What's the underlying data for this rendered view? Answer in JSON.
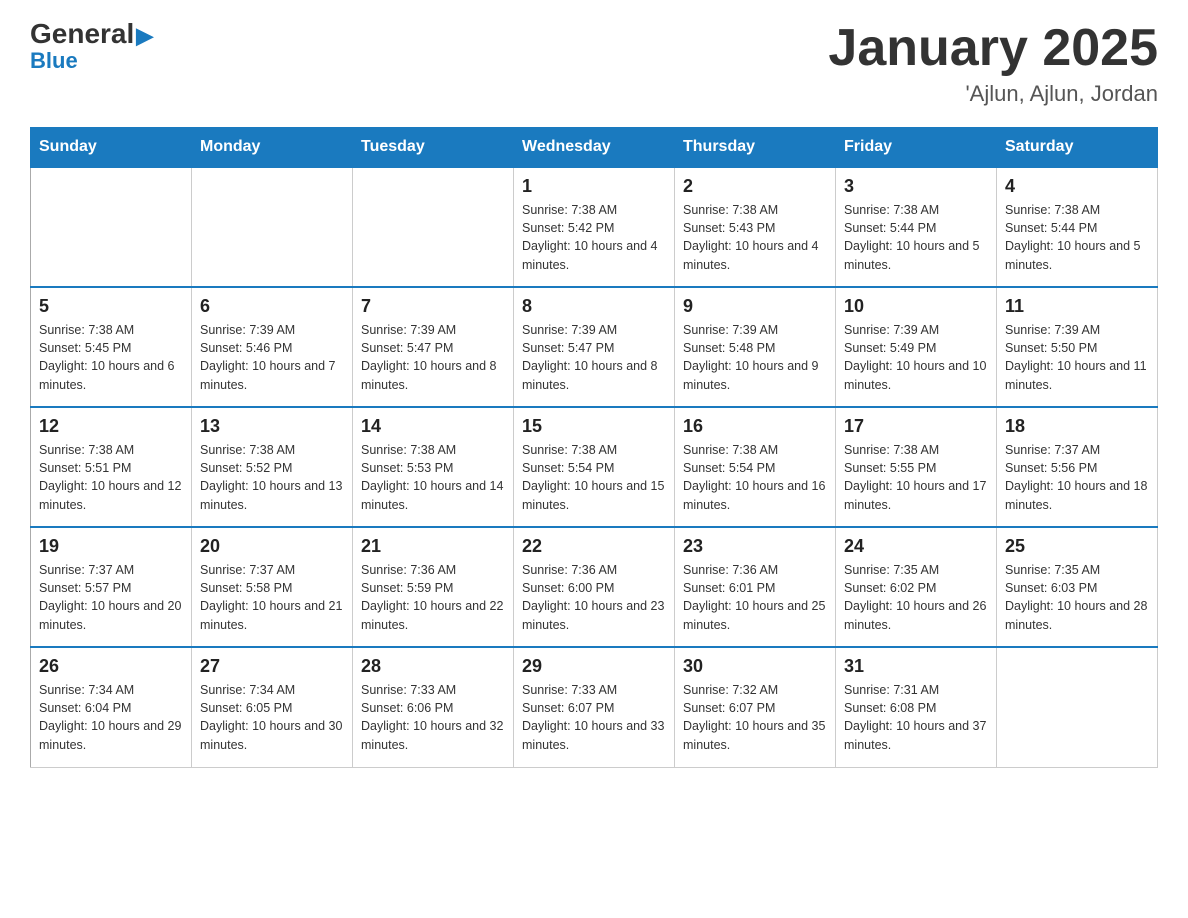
{
  "logo": {
    "general": "General",
    "blue": "Blue",
    "arrow": "▶"
  },
  "title": "January 2025",
  "subtitle": "'Ajlun, Ajlun, Jordan",
  "headers": [
    "Sunday",
    "Monday",
    "Tuesday",
    "Wednesday",
    "Thursday",
    "Friday",
    "Saturday"
  ],
  "weeks": [
    [
      {
        "day": "",
        "info": ""
      },
      {
        "day": "",
        "info": ""
      },
      {
        "day": "",
        "info": ""
      },
      {
        "day": "1",
        "info": "Sunrise: 7:38 AM\nSunset: 5:42 PM\nDaylight: 10 hours and 4 minutes."
      },
      {
        "day": "2",
        "info": "Sunrise: 7:38 AM\nSunset: 5:43 PM\nDaylight: 10 hours and 4 minutes."
      },
      {
        "day": "3",
        "info": "Sunrise: 7:38 AM\nSunset: 5:44 PM\nDaylight: 10 hours and 5 minutes."
      },
      {
        "day": "4",
        "info": "Sunrise: 7:38 AM\nSunset: 5:44 PM\nDaylight: 10 hours and 5 minutes."
      }
    ],
    [
      {
        "day": "5",
        "info": "Sunrise: 7:38 AM\nSunset: 5:45 PM\nDaylight: 10 hours and 6 minutes."
      },
      {
        "day": "6",
        "info": "Sunrise: 7:39 AM\nSunset: 5:46 PM\nDaylight: 10 hours and 7 minutes."
      },
      {
        "day": "7",
        "info": "Sunrise: 7:39 AM\nSunset: 5:47 PM\nDaylight: 10 hours and 8 minutes."
      },
      {
        "day": "8",
        "info": "Sunrise: 7:39 AM\nSunset: 5:47 PM\nDaylight: 10 hours and 8 minutes."
      },
      {
        "day": "9",
        "info": "Sunrise: 7:39 AM\nSunset: 5:48 PM\nDaylight: 10 hours and 9 minutes."
      },
      {
        "day": "10",
        "info": "Sunrise: 7:39 AM\nSunset: 5:49 PM\nDaylight: 10 hours and 10 minutes."
      },
      {
        "day": "11",
        "info": "Sunrise: 7:39 AM\nSunset: 5:50 PM\nDaylight: 10 hours and 11 minutes."
      }
    ],
    [
      {
        "day": "12",
        "info": "Sunrise: 7:38 AM\nSunset: 5:51 PM\nDaylight: 10 hours and 12 minutes."
      },
      {
        "day": "13",
        "info": "Sunrise: 7:38 AM\nSunset: 5:52 PM\nDaylight: 10 hours and 13 minutes."
      },
      {
        "day": "14",
        "info": "Sunrise: 7:38 AM\nSunset: 5:53 PM\nDaylight: 10 hours and 14 minutes."
      },
      {
        "day": "15",
        "info": "Sunrise: 7:38 AM\nSunset: 5:54 PM\nDaylight: 10 hours and 15 minutes."
      },
      {
        "day": "16",
        "info": "Sunrise: 7:38 AM\nSunset: 5:54 PM\nDaylight: 10 hours and 16 minutes."
      },
      {
        "day": "17",
        "info": "Sunrise: 7:38 AM\nSunset: 5:55 PM\nDaylight: 10 hours and 17 minutes."
      },
      {
        "day": "18",
        "info": "Sunrise: 7:37 AM\nSunset: 5:56 PM\nDaylight: 10 hours and 18 minutes."
      }
    ],
    [
      {
        "day": "19",
        "info": "Sunrise: 7:37 AM\nSunset: 5:57 PM\nDaylight: 10 hours and 20 minutes."
      },
      {
        "day": "20",
        "info": "Sunrise: 7:37 AM\nSunset: 5:58 PM\nDaylight: 10 hours and 21 minutes."
      },
      {
        "day": "21",
        "info": "Sunrise: 7:36 AM\nSunset: 5:59 PM\nDaylight: 10 hours and 22 minutes."
      },
      {
        "day": "22",
        "info": "Sunrise: 7:36 AM\nSunset: 6:00 PM\nDaylight: 10 hours and 23 minutes."
      },
      {
        "day": "23",
        "info": "Sunrise: 7:36 AM\nSunset: 6:01 PM\nDaylight: 10 hours and 25 minutes."
      },
      {
        "day": "24",
        "info": "Sunrise: 7:35 AM\nSunset: 6:02 PM\nDaylight: 10 hours and 26 minutes."
      },
      {
        "day": "25",
        "info": "Sunrise: 7:35 AM\nSunset: 6:03 PM\nDaylight: 10 hours and 28 minutes."
      }
    ],
    [
      {
        "day": "26",
        "info": "Sunrise: 7:34 AM\nSunset: 6:04 PM\nDaylight: 10 hours and 29 minutes."
      },
      {
        "day": "27",
        "info": "Sunrise: 7:34 AM\nSunset: 6:05 PM\nDaylight: 10 hours and 30 minutes."
      },
      {
        "day": "28",
        "info": "Sunrise: 7:33 AM\nSunset: 6:06 PM\nDaylight: 10 hours and 32 minutes."
      },
      {
        "day": "29",
        "info": "Sunrise: 7:33 AM\nSunset: 6:07 PM\nDaylight: 10 hours and 33 minutes."
      },
      {
        "day": "30",
        "info": "Sunrise: 7:32 AM\nSunset: 6:07 PM\nDaylight: 10 hours and 35 minutes."
      },
      {
        "day": "31",
        "info": "Sunrise: 7:31 AM\nSunset: 6:08 PM\nDaylight: 10 hours and 37 minutes."
      },
      {
        "day": "",
        "info": ""
      }
    ]
  ]
}
